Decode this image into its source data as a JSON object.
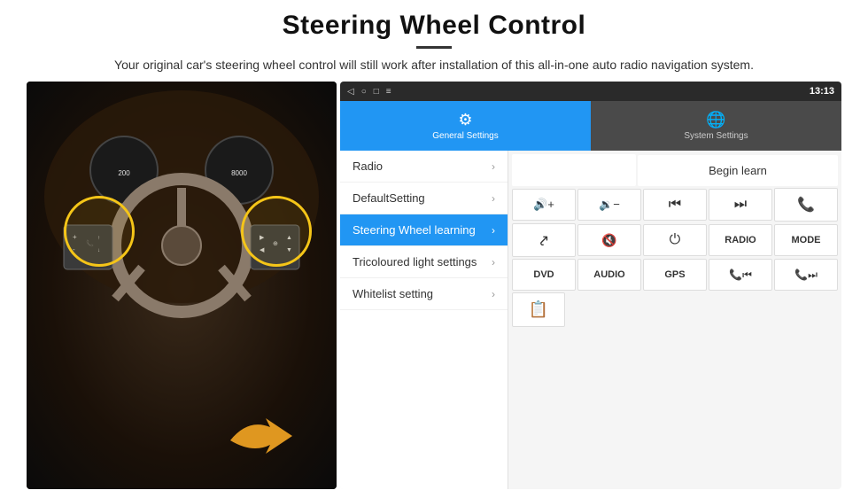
{
  "header": {
    "title": "Steering Wheel Control",
    "divider": true,
    "subtitle": "Your original car's steering wheel control will still work after installation of this all-in-one auto radio navigation system."
  },
  "status_bar": {
    "back_icon": "◁",
    "home_icon": "○",
    "square_icon": "□",
    "menu_icon": "≡",
    "location_icon": "♦",
    "signal_icon": "▲",
    "time": "13:13"
  },
  "nav_tabs": [
    {
      "id": "general",
      "label": "General Settings",
      "icon": "⚙",
      "active": true
    },
    {
      "id": "system",
      "label": "System Settings",
      "icon": "🌐",
      "active": false
    }
  ],
  "menu_items": [
    {
      "id": "radio",
      "label": "Radio",
      "active": false
    },
    {
      "id": "defaultsetting",
      "label": "DefaultSetting",
      "active": false
    },
    {
      "id": "steering",
      "label": "Steering Wheel learning",
      "active": true
    },
    {
      "id": "tricoloured",
      "label": "Tricoloured light settings",
      "active": false
    },
    {
      "id": "whitelist",
      "label": "Whitelist setting",
      "active": false
    }
  ],
  "control_panel": {
    "begin_learn_label": "Begin learn",
    "rows": [
      [
        {
          "id": "vol_up",
          "icon": "▶+",
          "symbol": "🔊",
          "label": "Vol+"
        },
        {
          "id": "vol_down",
          "symbol": "🔉",
          "label": "Vol−"
        },
        {
          "id": "prev_track",
          "symbol": "⏮",
          "label": "Prev"
        },
        {
          "id": "next_track",
          "symbol": "⏭",
          "label": "Next"
        },
        {
          "id": "phone",
          "symbol": "📞",
          "label": "Phone"
        }
      ],
      [
        {
          "id": "hang_up",
          "symbol": "↩",
          "label": "Hang"
        },
        {
          "id": "mute",
          "symbol": "🔇",
          "label": "Mute"
        },
        {
          "id": "power",
          "symbol": "⏻",
          "label": "Power"
        },
        {
          "id": "radio_btn",
          "text": "RADIO",
          "label": "RADIO"
        },
        {
          "id": "mode_btn",
          "text": "MODE",
          "label": "MODE"
        }
      ],
      [
        {
          "id": "dvd_btn",
          "text": "DVD",
          "label": "DVD"
        },
        {
          "id": "audio_btn",
          "text": "AUDIO",
          "label": "AUDIO"
        },
        {
          "id": "gps_btn",
          "text": "GPS",
          "label": "GPS"
        },
        {
          "id": "phone_prev",
          "symbol": "📞⏮",
          "label": "PhPrev"
        },
        {
          "id": "phone_next",
          "symbol": "📞⏭",
          "label": "PhNext"
        }
      ],
      [
        {
          "id": "folder_icon",
          "symbol": "📁",
          "label": "Folder"
        }
      ]
    ]
  }
}
